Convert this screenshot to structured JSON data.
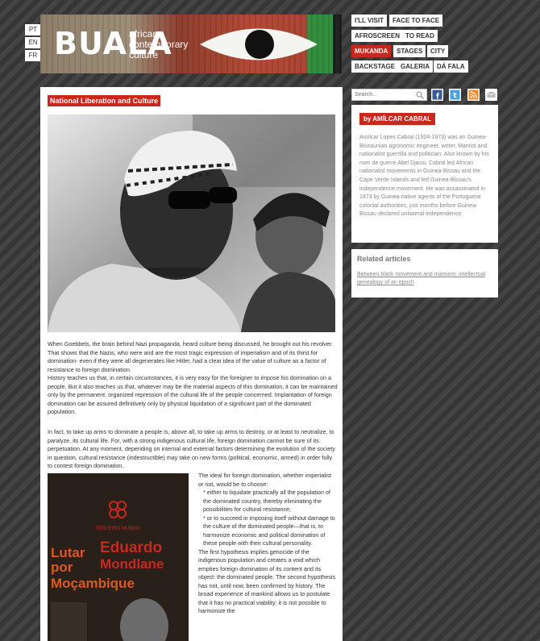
{
  "languages": [
    "PT",
    "EN",
    "FR"
  ],
  "header": {
    "logo": "BUALA",
    "tagline": [
      "african",
      "contemporary",
      "culture"
    ]
  },
  "nav": {
    "items": [
      {
        "label": "I'LL VISIT",
        "active": false
      },
      {
        "label": "FACE TO FACE",
        "active": false
      },
      {
        "label": "AFROSCREEN",
        "active": false
      },
      {
        "label": "TO READ",
        "active": false
      },
      {
        "label": "MUKANDA",
        "active": true
      },
      {
        "label": "STAGES",
        "active": false
      },
      {
        "label": "CITY",
        "active": false
      },
      {
        "label": "BACKSTAGE",
        "active": false
      },
      {
        "label": "GALERIA",
        "active": false
      },
      {
        "label": "DÁ FALA",
        "active": false
      }
    ],
    "active_color": "#c8281e"
  },
  "article": {
    "title": "National Liberation and Culture",
    "paragraph1": "When Goebbels, the brain behind Nazi propaganda, heard culture being discussed, he brought out his revolver. That shows that the Nazis, who were and are the most tragic expression of imperialism and of its thirst for domination- even if they were all degenerates like Hitler, had a clear idea of the value of culture as a factor of resistance to foreign domination.",
    "paragraph1b": "History teaches us that, in certain circumstances, it is very easy for the foreigner to impose his domination on a people. But it also teaches us that, whatever may be the material aspects of this domination, it can be maintained only by the permanent, organized repression of the cultural life of the people concerned. Implantation of foreign domination can be assured definitively only by physical liquidation of a significant part of the dominated population.",
    "paragraph2": "In fact, to take up arms to dominate a people is, above all, to take up arms to destroy, or at least to neutralize, to paralyze, its cultural life. For, with a strong indigenous cultural life, foreign domination cannot be sure of its perpetuation. At any moment, depending on internal and external factors determining the evolution of the society in question, cultural resistance (indestructible) may take on new forms (political, economic, armed) in order fully to contest foreign domination.",
    "paragraph3": "The ideal for foreign domination, whether imperialist or not, would be to choose:",
    "bullet1": "* either to liquidate practically all the population of the dominated country, thereby eliminating the possibilities for cultural resistance;",
    "bullet2": "* or to succeed in imposing itself without damage to the culture of the dominated people—that is, to harmonize economic and political domination of these people with their cultural personality.",
    "paragraph4": "The first hypothesis implies genocide of the indigenous population and creates a void which empties foreign domination of its content and its object: the dominated people. The second hypothesis has not, until now, been confirmed by history. The broad experience of mankind allows us to postulate that it has no practical viability: it is not possible to harmonize the"
  },
  "book_cover": {
    "publisher": "TERCEIRO MUNDO",
    "title_left": [
      "Lutar",
      "por"
    ],
    "title_right": [
      "Eduardo",
      "Mondlane"
    ],
    "title_bottom": "Moçambique"
  },
  "sidebar": {
    "search_placeholder": "Search...",
    "author_tag": "by AMÍLCAR CABRAL",
    "author_bio": "Amílcar Lopes Cabral (1924-1973) was an Guinea-Bissaunian agronomic engineer, writer, Marxist and nationalist guerrilla and politician. Also known by his nom de guerre Abel Djassi, Cabral led African nationalist movements in Guinea-Bissau and the Cape Verde Islands and led Guinea-Bissau's independence movement. He was assassinated in 1973 by Guinea-native agents of the Portuguese colonial authorities, just months before Guinea-Bissau declared unilateral independence.",
    "related_title": "Related articles",
    "related_links": [
      "Between black movement and marxism: intellectual genealogy of an epoch"
    ],
    "social_icons": [
      "search-icon",
      "facebook-icon",
      "twitter-icon",
      "rss-icon",
      "mail-icon"
    ]
  }
}
